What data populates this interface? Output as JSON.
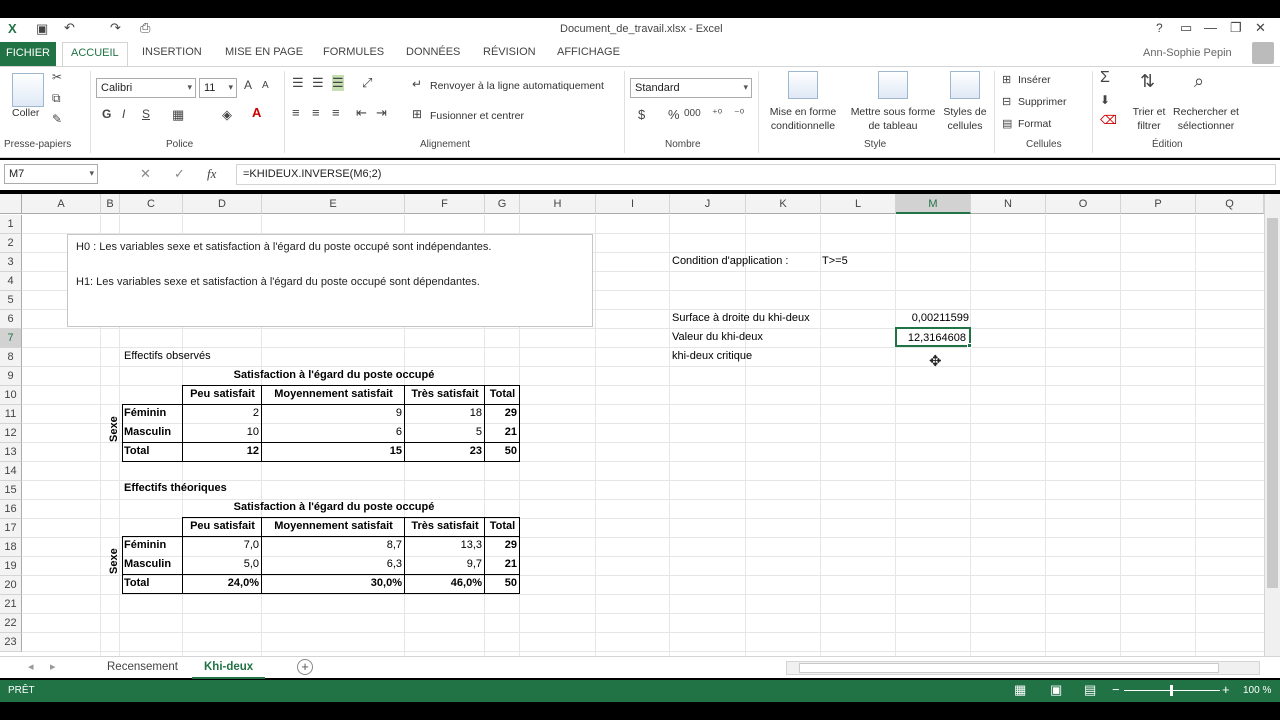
{
  "window": {
    "title": "Document_de_travail.xlsx - Excel",
    "user": "Ann-Sophie Pepin",
    "help": "?"
  },
  "tabs": [
    "FICHIER",
    "ACCUEIL",
    "INSERTION",
    "MISE EN PAGE",
    "FORMULES",
    "DONNÉES",
    "RÉVISION",
    "AFFICHAGE"
  ],
  "ribbon": {
    "clipboard": {
      "paste": "Coller",
      "label": "Presse-papiers"
    },
    "font": {
      "name": "Calibri",
      "size": "11",
      "label": "Police",
      "bold": "G",
      "italic": "I",
      "underline": "S",
      "grow": "A",
      "shrink": "A"
    },
    "alignment": {
      "wrap": "Renvoyer à la ligne automatiquement",
      "merge": "Fusionner et centrer",
      "label": "Alignement"
    },
    "number": {
      "format": "Standard",
      "currency": "$",
      "percent": "%",
      "thousands": "000",
      "label": "Nombre"
    },
    "styles": {
      "cond": "Mise en forme conditionnelle",
      "table": "Mettre sous forme de tableau",
      "cell": "Styles de cellules",
      "label": "Style"
    },
    "cells": {
      "insert": "Insérer",
      "delete": "Supprimer",
      "format": "Format",
      "label": "Cellules"
    },
    "editing": {
      "sort": "Trier et filtrer",
      "find": "Rechercher et sélectionner",
      "label": "Édition"
    }
  },
  "formula_bar": {
    "name_box": "M7",
    "formula": "=KHIDEUX.INVERSE(M6;2)",
    "fx": "fx"
  },
  "columns": [
    "A",
    "B",
    "C",
    "D",
    "E",
    "F",
    "G",
    "H",
    "I",
    "J",
    "K",
    "L",
    "M",
    "N",
    "O",
    "P",
    "Q"
  ],
  "rows": [
    "1",
    "2",
    "3",
    "4",
    "5",
    "6",
    "7",
    "8",
    "9",
    "10",
    "11",
    "12",
    "13",
    "14",
    "15",
    "16",
    "17",
    "18",
    "19",
    "20",
    "21",
    "22",
    "23"
  ],
  "hypotheses": {
    "h0": "H0 : Les variables sexe et satisfaction à l'égard du poste occupé sont indépendantes.",
    "h1": "H1: Les variables sexe et satisfaction à l'égard du poste occupé sont dépendantes."
  },
  "observed": {
    "title": "Effectifs observés",
    "header": "Satisfaction à l'égard du poste occupé",
    "cols": [
      "Peu satisfait",
      "Moyennement satisfait",
      "Très satisfait",
      "Total"
    ],
    "row_group": "Sexe",
    "rows": [
      {
        "label": "Féminin",
        "values": [
          "2",
          "9",
          "18",
          "29"
        ]
      },
      {
        "label": "Masculin",
        "values": [
          "10",
          "6",
          "5",
          "21"
        ]
      },
      {
        "label": "Total",
        "values": [
          "12",
          "15",
          "23",
          "50"
        ]
      }
    ]
  },
  "theoretical": {
    "title": "Effectifs théoriques",
    "header": "Satisfaction à l'égard du poste occupé",
    "cols": [
      "Peu satisfait",
      "Moyennement satisfait",
      "Très satisfait",
      "Total"
    ],
    "row_group": "Sexe",
    "rows": [
      {
        "label": "Féminin",
        "values": [
          "7,0",
          "8,7",
          "13,3",
          "29"
        ]
      },
      {
        "label": "Masculin",
        "values": [
          "5,0",
          "6,3",
          "9,7",
          "21"
        ]
      },
      {
        "label": "Total",
        "values": [
          "24,0%",
          "30,0%",
          "46,0%",
          "50"
        ]
      }
    ]
  },
  "results": {
    "condition_label": "Condition d'application :",
    "condition_value": "T>=5",
    "surface_label": "Surface à droite du khi-deux",
    "surface_value": "0,00211599",
    "khi_label": "Valeur du khi-deux",
    "khi_value": "12,3164608",
    "critique_label": "khi-deux critique"
  },
  "sheets": {
    "tab1": "Recensement",
    "tab2": "Khi-deux",
    "add": "+"
  },
  "status": {
    "mode": "PRÊT",
    "zoom": "100 %"
  }
}
